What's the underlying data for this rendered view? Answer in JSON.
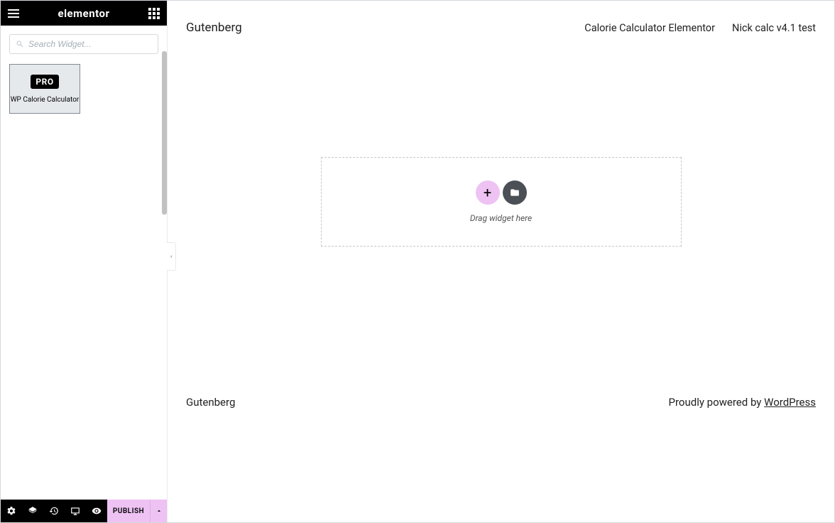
{
  "sidebar": {
    "brand": "elementor",
    "search_placeholder": "Search Widget...",
    "widget": {
      "badge": "PRO",
      "label": "WP Calorie Calculator"
    }
  },
  "footer": {
    "publish_label": "PUBLISH"
  },
  "canvas": {
    "site_title": "Gutenberg",
    "nav": {
      "link1": "Calorie Calculator Elementor",
      "link2": "Nick calc v4.1 test"
    },
    "dropzone": {
      "hint": "Drag widget here"
    },
    "footer_left": "Gutenberg",
    "footer_powered": "Proudly powered by ",
    "footer_link": "WordPress"
  }
}
